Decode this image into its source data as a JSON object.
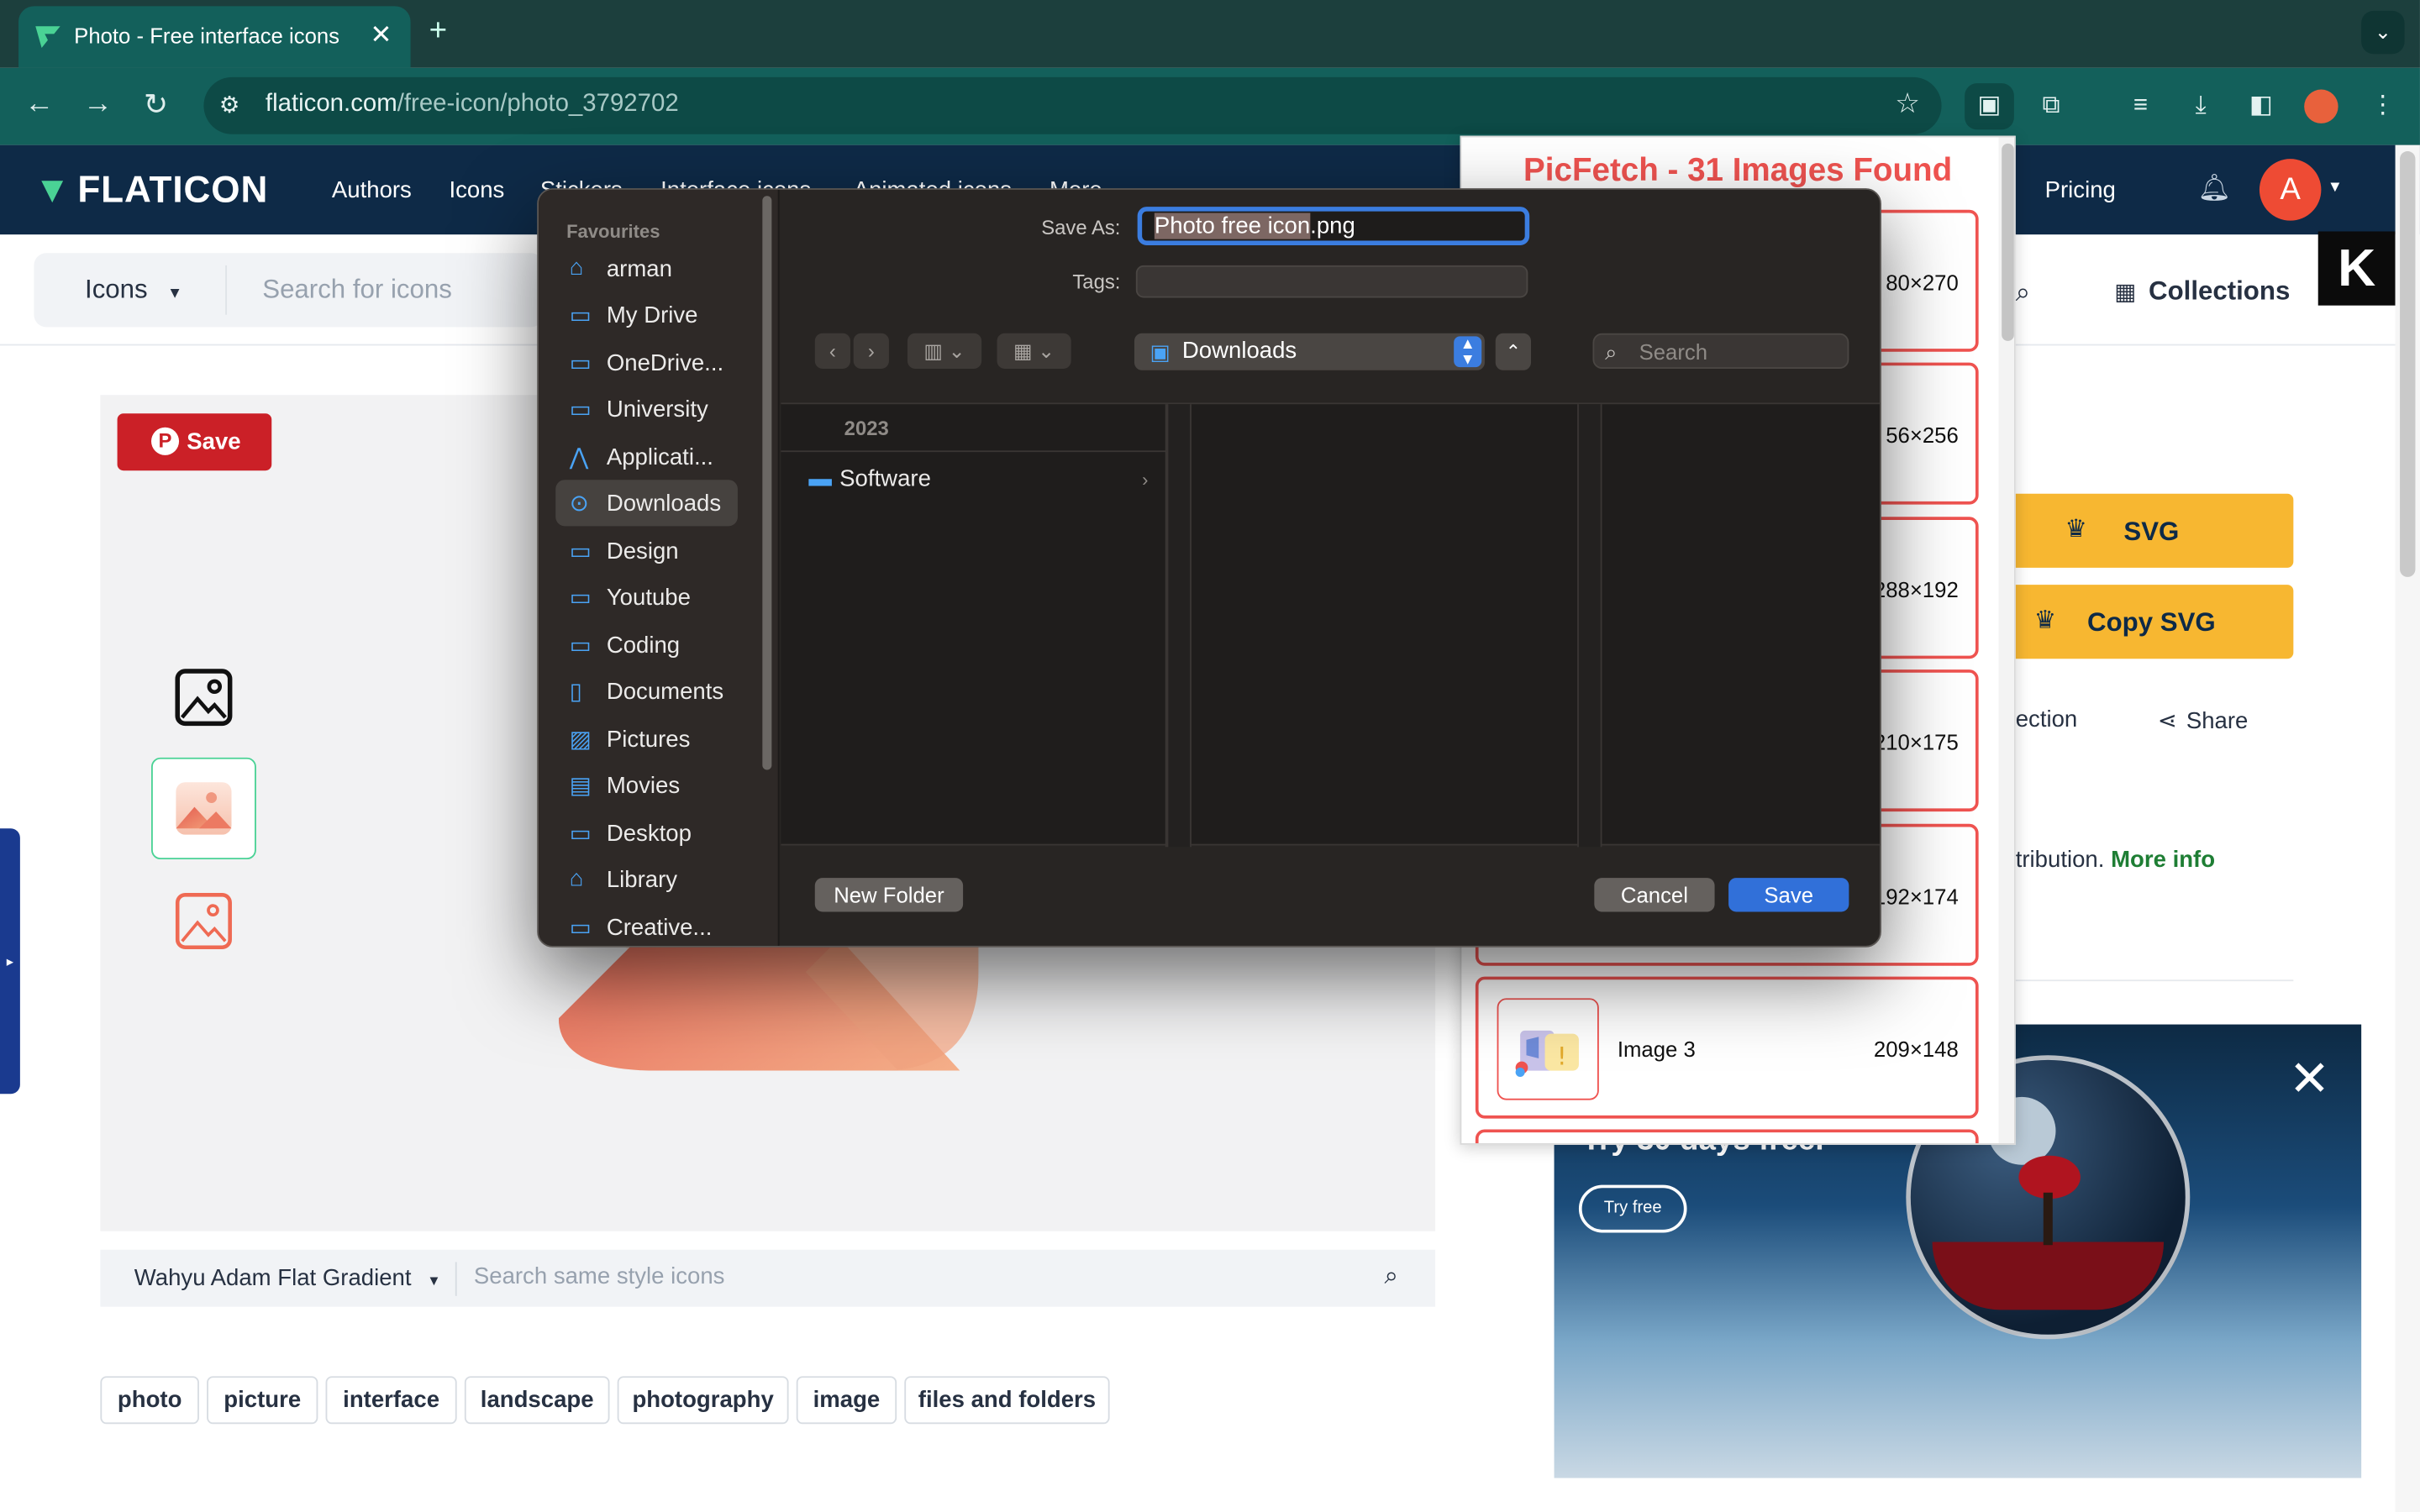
{
  "browser": {
    "tab_title": "Photo - Free interface icons",
    "url_host": "flaticon.com",
    "url_path": "/free-icon/photo_3792702"
  },
  "site": {
    "logo": "FLATICON",
    "nav": [
      "Authors",
      "Icons",
      "Stickers",
      "Interface icons",
      "Animated icons",
      "More"
    ],
    "pricing": "Pricing",
    "avatar_letter": "A",
    "search_scope": "Icons",
    "search_placeholder": "Search for icons",
    "collections": "Collections"
  },
  "preview": {
    "pin_save": "Save",
    "style_name": "Wahyu Adam Flat Gradient",
    "style_search_placeholder": "Search same style icons",
    "tags": [
      "photo",
      "picture",
      "interface",
      "landscape",
      "photography",
      "image",
      "files and folders"
    ]
  },
  "right": {
    "svg_button": "SVG",
    "copy_svg_button": "Copy SVG",
    "collection_partial": "ection",
    "share": "Share",
    "attribution_partial": "tribution.",
    "more_info": "More info"
  },
  "picfetch": {
    "title": "PicFetch  - 31 Images Found",
    "cards": [
      {
        "name": "",
        "dims": "80×270"
      },
      {
        "name": "",
        "dims": "56×256"
      },
      {
        "name": "",
        "dims": "288×192"
      },
      {
        "name": "",
        "dims": "210×175"
      },
      {
        "name": "",
        "dims": "192×174"
      },
      {
        "name": "Image 3",
        "dims": "209×148"
      }
    ]
  },
  "ad": {
    "headline": "Try 30 days free.",
    "cta": "Try free"
  },
  "dialog": {
    "save_as_label": "Save As:",
    "filename_selected": "Photo free icon",
    "filename_ext": ".png",
    "tags_label": "Tags:",
    "location": "Downloads",
    "search_placeholder": "Search",
    "sidebar_header": "Favourites",
    "sidebar": [
      {
        "label": "arman",
        "icon": "home-icon"
      },
      {
        "label": "My Drive",
        "icon": "folder-icon"
      },
      {
        "label": "OneDrive...",
        "icon": "folder-icon"
      },
      {
        "label": "University",
        "icon": "folder-icon"
      },
      {
        "label": "Applicati...",
        "icon": "applications-icon"
      },
      {
        "label": "Downloads",
        "icon": "download-icon"
      },
      {
        "label": "Design",
        "icon": "folder-icon"
      },
      {
        "label": "Youtube",
        "icon": "folder-icon"
      },
      {
        "label": "Coding",
        "icon": "folder-icon"
      },
      {
        "label": "Documents",
        "icon": "document-icon"
      },
      {
        "label": "Pictures",
        "icon": "pictures-icon"
      },
      {
        "label": "Movies",
        "icon": "movies-icon"
      },
      {
        "label": "Desktop",
        "icon": "desktop-icon"
      },
      {
        "label": "Library",
        "icon": "library-icon"
      },
      {
        "label": "Creative...",
        "icon": "folder-icon"
      }
    ],
    "column_header": "2023",
    "folder": "Software",
    "new_folder": "New Folder",
    "cancel": "Cancel",
    "save": "Save"
  }
}
